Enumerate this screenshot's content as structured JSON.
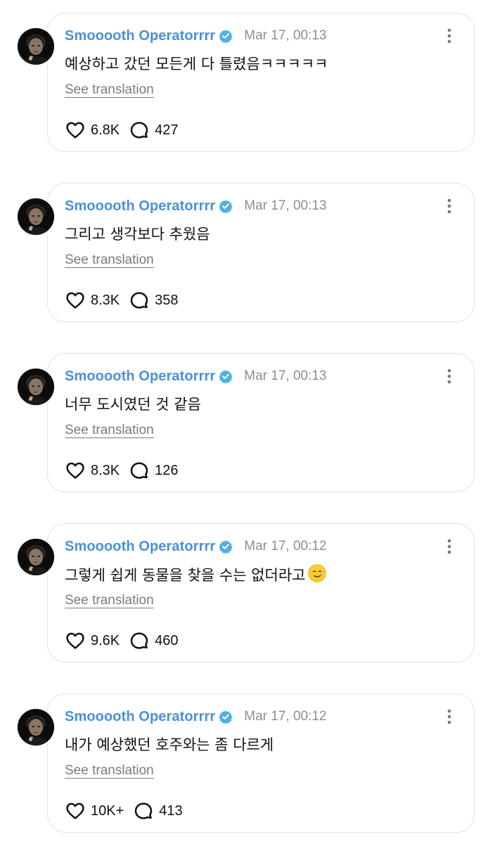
{
  "theme": {
    "username_color": "#4a90d9",
    "verified_color": "#4fb1e3",
    "timestamp_color": "#8e8e93",
    "link_color": "#7b7b80",
    "text_color": "#111111",
    "card_border": "#e3e3e3"
  },
  "icons": {
    "verified": "verified-badge-icon",
    "more": "vertical-ellipsis-icon",
    "like": "heart-outline-icon",
    "reply": "speech-bubble-icon",
    "emoji": "smiling-face-with-tear"
  },
  "posts": [
    {
      "username": "Smooooth Operatorrrr",
      "timestamp": "Mar 17, 00:13",
      "text": "예상하고 갔던 모든게 다 틀렸음ㅋㅋㅋㅋㅋ",
      "see_translation": "See translation",
      "likes": "6.8K",
      "replies": "427"
    },
    {
      "username": "Smooooth Operatorrrr",
      "timestamp": "Mar 17, 00:13",
      "text": "그리고 생각보다 추웠음",
      "see_translation": "See translation",
      "likes": "8.3K",
      "replies": "358"
    },
    {
      "username": "Smooooth Operatorrrr",
      "timestamp": "Mar 17, 00:13",
      "text": "너무 도시였던 것 같음",
      "see_translation": "See translation",
      "likes": "8.3K",
      "replies": "126"
    },
    {
      "username": "Smooooth Operatorrrr",
      "timestamp": "Mar 17, 00:12",
      "text": "그렇게 쉽게 동물을 찾을 수는 없더라고",
      "has_emoji": true,
      "see_translation": "See translation",
      "likes": "9.6K",
      "replies": "460"
    },
    {
      "username": "Smooooth Operatorrrr",
      "timestamp": "Mar 17, 00:12",
      "text": "내가 예상했던 호주와는 좀 다르게",
      "see_translation": "See translation",
      "likes": "10K+",
      "replies": "413"
    }
  ]
}
